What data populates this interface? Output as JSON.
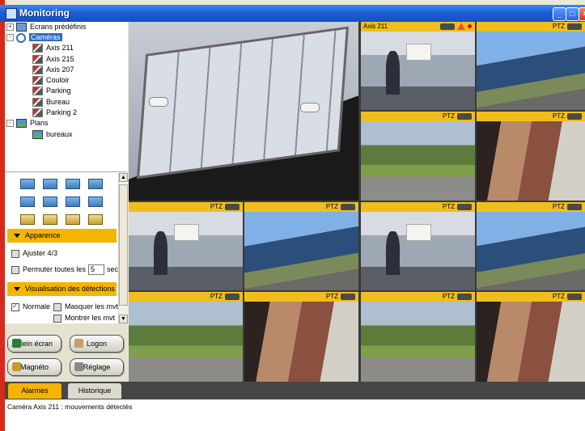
{
  "window": {
    "title": "Monitoring"
  },
  "tree": {
    "items": [
      {
        "label": "Ecrans prédéfinis",
        "level": 0,
        "expander": "+",
        "icon": "screen-icon"
      },
      {
        "label": "Caméras",
        "level": 0,
        "expander": "-",
        "icon": "search-icon",
        "selected": true
      },
      {
        "label": "Axis 211",
        "level": 1,
        "icon": "camera-icon"
      },
      {
        "label": "Axis 215",
        "level": 1,
        "icon": "camera-icon"
      },
      {
        "label": "Axis 207",
        "level": 1,
        "icon": "camera-icon"
      },
      {
        "label": "Couloir",
        "level": 1,
        "icon": "camera-icon"
      },
      {
        "label": "Parking",
        "level": 1,
        "icon": "camera-icon"
      },
      {
        "label": "Bureau",
        "level": 1,
        "icon": "camera-icon"
      },
      {
        "label": "Parking 2",
        "level": 1,
        "icon": "camera-icon"
      },
      {
        "label": "Plans",
        "level": 0,
        "expander": "-",
        "icon": "map-icon"
      },
      {
        "label": "bureaux",
        "level": 1,
        "icon": "map-icon"
      }
    ]
  },
  "panel": {
    "appearance_title": "Apparence",
    "adjust_label": "Ajuster 4/3",
    "permute_label": "Permuter toutes les",
    "permute_value": "5",
    "permute_unit": "sec",
    "detections_title": "Visualisation des détections",
    "normal_label": "Normale",
    "hide_moves_label": "Masquer les mvt",
    "show_moves_label": "Montrer les mvt"
  },
  "buttons": {
    "fullscreen": "Plein écran",
    "logon": "Logon",
    "magneto": "Magnéto",
    "settings": "Réglage"
  },
  "tabs": {
    "alarms": "Alarmes",
    "history": "Historique"
  },
  "status": {
    "message": "Caméra Axis 211 : mouvements détectés"
  },
  "tiles": {
    "axis211": "Axis 211",
    "ptz": "PTZ"
  },
  "colors": {
    "accent": "#f4b400",
    "titlebar": "#1d5fd4",
    "tile_header": "#f0be1c"
  }
}
